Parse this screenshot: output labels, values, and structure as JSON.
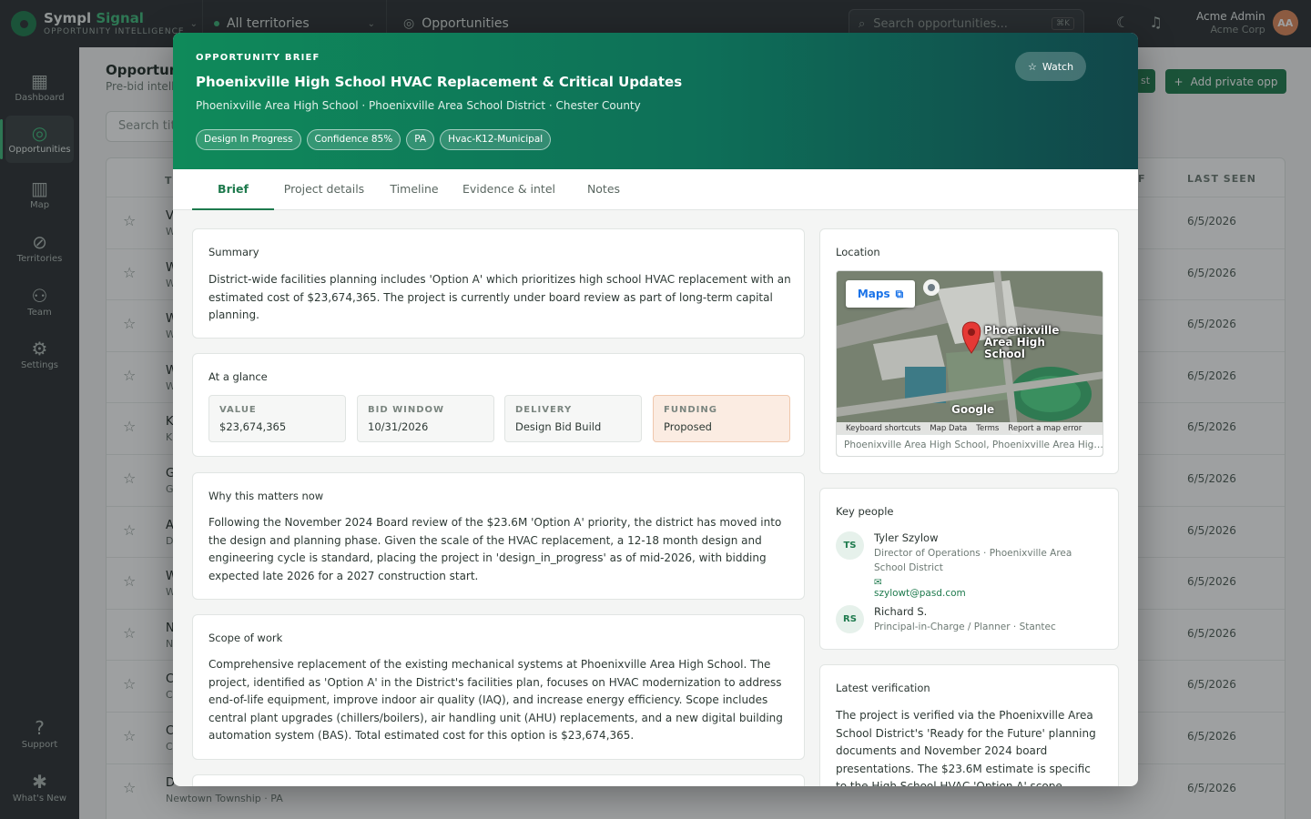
{
  "topbar": {
    "brand_name_a": "Sympl",
    "brand_name_b": "Signal",
    "brand_sub": "OPPORTUNITY INTELLIGENCE",
    "territory": "All territories",
    "section": "Opportunities",
    "search_placeholder": "Search opportunities...",
    "search_shortcut": "⌘K",
    "user_name": "Acme Admin",
    "user_org": "Acme Corp",
    "user_initials": "AA"
  },
  "nav": [
    {
      "label": "Dashboard",
      "icon": "dashboard-icon"
    },
    {
      "label": "Opportunities",
      "icon": "target-icon"
    },
    {
      "label": "Map",
      "icon": "map-icon"
    },
    {
      "label": "Territories",
      "icon": "compass-icon"
    },
    {
      "label": "Team",
      "icon": "team-icon"
    },
    {
      "label": "Settings",
      "icon": "gear-icon"
    },
    {
      "label": "Support",
      "icon": "help-icon"
    },
    {
      "label": "What's New",
      "icon": "badge-icon"
    }
  ],
  "background": {
    "title": "Opportuniti",
    "subtitle": "Pre-bid intell",
    "ghost_btn": "st",
    "add_btn": "Add private opp",
    "search_placeholder": "Search title",
    "col_frag": "T",
    "col_frag_right": "F",
    "col_last_seen": "LAST SEEN",
    "rows": [
      {
        "l1": "V",
        "l2": "W",
        "date": "6/5/2026"
      },
      {
        "l1": "W",
        "l2": "W",
        "date": "6/5/2026"
      },
      {
        "l1": "W",
        "l2": "W",
        "date": "6/5/2026"
      },
      {
        "l1": "W",
        "l2": "W",
        "date": "6/5/2026"
      },
      {
        "l1": "K",
        "l2": "K",
        "date": "6/5/2026"
      },
      {
        "l1": "G",
        "l2": "G",
        "date": "6/5/2026"
      },
      {
        "l1": "A",
        "l2": "D",
        "date": "6/5/2026"
      },
      {
        "l1": "W",
        "l2": "W",
        "date": "6/5/2026"
      },
      {
        "l1": "N",
        "l2": "N",
        "date": "6/5/2026"
      },
      {
        "l1": "C",
        "l2": "C",
        "date": "6/5/2026"
      },
      {
        "l1": "C",
        "l2": "C",
        "date": "6/5/2026"
      },
      {
        "l1": "D",
        "l2": "Newtown Township · PA",
        "date": "6/5/2026"
      }
    ]
  },
  "modal": {
    "eyebrow": "OPPORTUNITY BRIEF",
    "title": "Phoenixville High School HVAC Replacement & Critical Updates",
    "subtitle": "Phoenixville Area High School · Phoenixville Area School District · Chester County",
    "chips": [
      "Design In Progress",
      "Confidence 85%",
      "PA",
      "Hvac-K12-Municipal"
    ],
    "watch": "Watch",
    "tabs": [
      "Brief",
      "Project details",
      "Timeline",
      "Evidence & intel",
      "Notes"
    ],
    "summary": {
      "title": "Summary",
      "text": "District-wide facilities planning includes 'Option A' which prioritizes high school HVAC replacement with an estimated cost of $23,674,365. The project is currently under board review as part of long-term capital planning."
    },
    "glance": {
      "title": "At a glance",
      "items": [
        {
          "label": "VALUE",
          "value": "$23,674,365"
        },
        {
          "label": "BID WINDOW",
          "value": "10/31/2026"
        },
        {
          "label": "DELIVERY",
          "value": "Design Bid Build"
        },
        {
          "label": "FUNDING",
          "value": "Proposed"
        }
      ]
    },
    "why": {
      "title": "Why this matters now",
      "text": "Following the November 2024 Board review of the $23.6M 'Option A' priority, the district has moved into the design and planning phase. Given the scale of the HVAC replacement, a 12-18 month design and engineering cycle is standard, placing the project in 'design_in_progress' as of mid-2026, with bidding expected late 2026 for a 2027 construction start."
    },
    "scope": {
      "title": "Scope of work",
      "text": "Comprehensive replacement of the existing mechanical systems at Phoenixville Area High School. The project, identified as 'Option A' in the District's facilities plan, focuses on HVAC modernization to address end-of-life equipment, improve indoor air quality (IAQ), and increase energy efficiency. Scope includes central plant upgrades (chillers/boilers), air handling unit (AHU) replacements, and a new digital building automation system (BAS). Total estimated cost for this option is $23,674,365."
    },
    "location": {
      "title": "Location",
      "maps_btn": "Maps",
      "map_label": "Phoenixville Area High School",
      "map_brand": "Google",
      "map_links": [
        "Keyboard shortcuts",
        "Map Data",
        "Terms",
        "Report a map error"
      ],
      "caption": "Phoenixville Area High School, Phoenixville Area High School"
    },
    "people": {
      "title": "Key people",
      "list": [
        {
          "initials": "TS",
          "name": "Tyler Szylow",
          "role": "Director of Operations · Phoenixville Area School District",
          "email": "szylowt@pasd.com"
        },
        {
          "initials": "RS",
          "name": "Richard S.",
          "role": "Principal-in-Charge / Planner · Stantec",
          "email": ""
        }
      ]
    },
    "verification": {
      "title": "Latest verification",
      "text": "The project is verified via the Phoenixville Area School District's 'Ready for the Future' planning documents and November 2024 board presentations. The $23.6M estimate is specific to the High School HVAC 'Option A' scope. Stantec is"
    }
  }
}
